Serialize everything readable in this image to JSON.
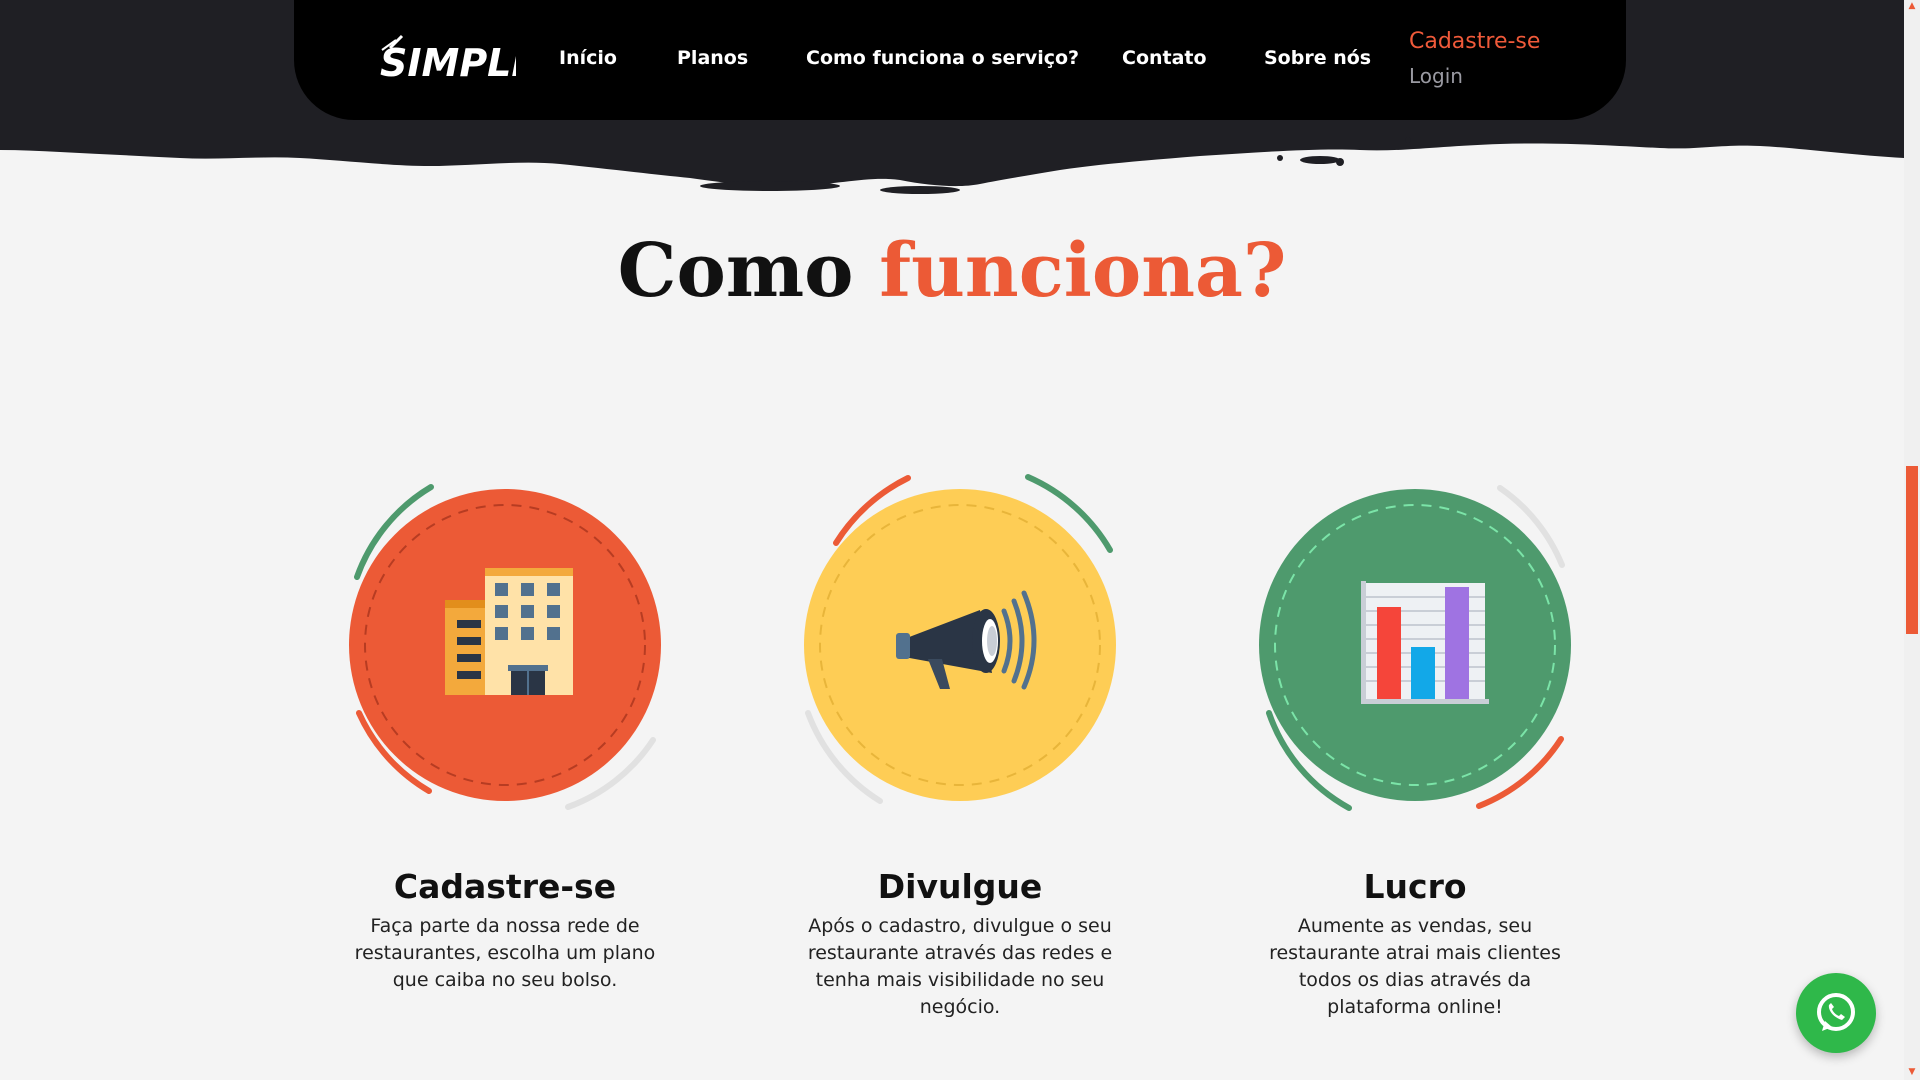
{
  "brand": {
    "logo_text": "SIMPLE"
  },
  "nav": {
    "links": [
      "Início",
      "Planos",
      "Como funciona o serviço?",
      "Contato",
      "Sobre nós"
    ],
    "cadastre": "Cadastre-se",
    "login": "Login"
  },
  "section": {
    "title_main": "Como",
    "title_accent": "funciona?"
  },
  "cards": [
    {
      "title": "Cadastre-se",
      "description": "Faça parte da nossa rede de restaurantes, escolha um plano que caiba no seu bolso.",
      "icon": "building-icon",
      "color": "#ec5a36"
    },
    {
      "title": "Divulgue",
      "description": "Após o cadastro, divulgue o seu restaurante através das redes e tenha mais visibilidade no seu negócio.",
      "icon": "megaphone-icon",
      "color": "#fecd55"
    },
    {
      "title": "Lucro",
      "description": "Aumente as vendas, seu restaurante atrai mais clientes todos os dias através da plataforma online!",
      "icon": "bar-chart-icon",
      "color": "#4e9a6d"
    }
  ],
  "colors": {
    "accent": "#ec5a36",
    "yellow": "#fecd55",
    "green": "#4e9a6d",
    "dark": "#1f1f24",
    "whatsapp": "#2fb84a"
  }
}
